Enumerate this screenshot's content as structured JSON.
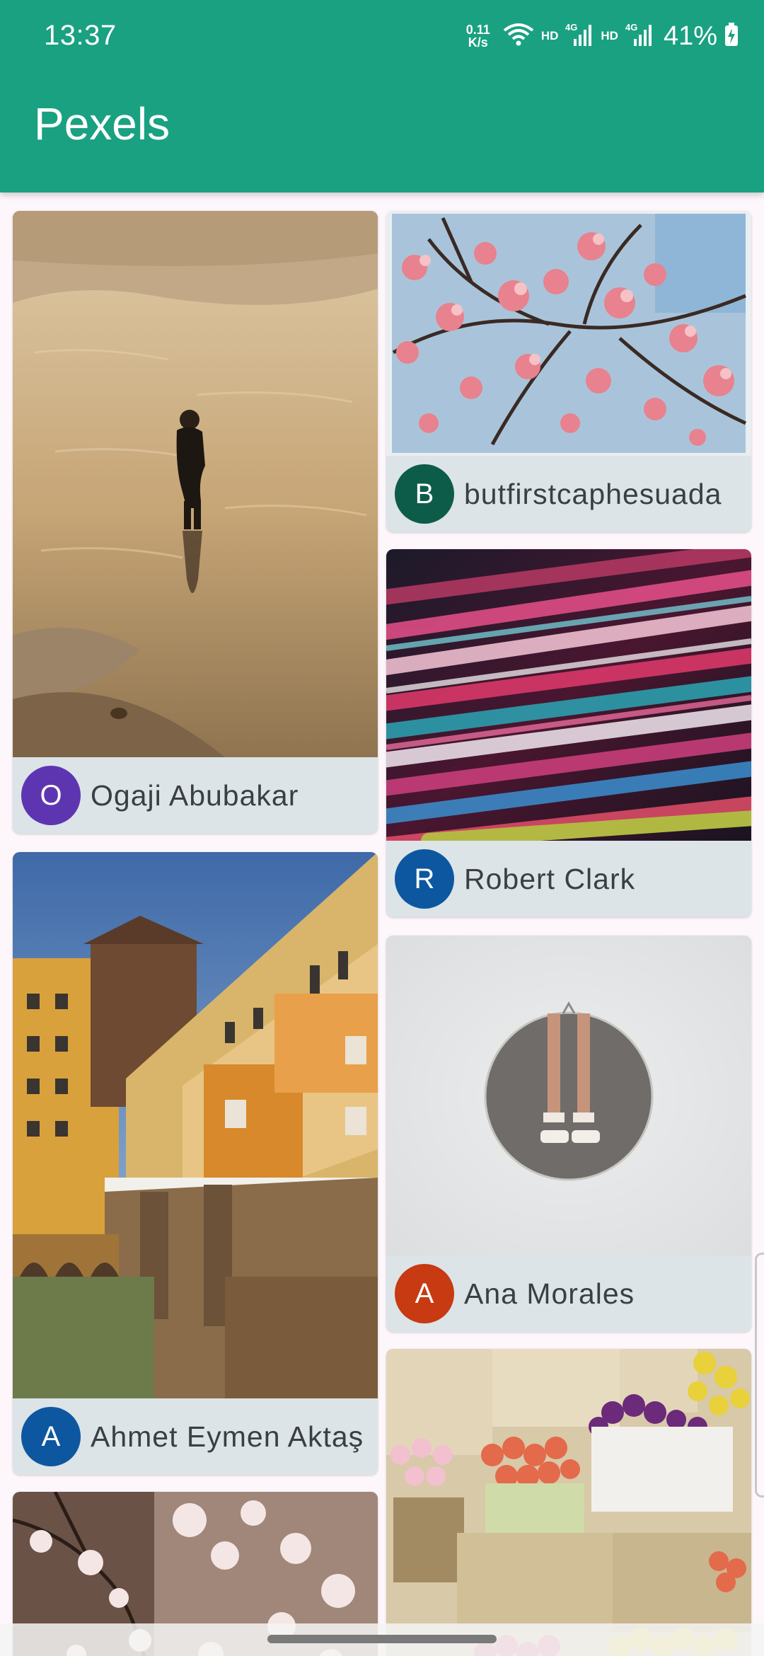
{
  "status_bar": {
    "time": "13:37",
    "net_speed_value": "0.11",
    "net_speed_unit": "K/s",
    "hd_label_1": "HD",
    "net_type_1": "4G",
    "hd_label_2": "HD",
    "net_type_2": "4G",
    "battery": "41%"
  },
  "toolbar": {
    "title": "Pexels"
  },
  "photos": [
    {
      "author": "Ogaji  Abubakar",
      "initial": "O",
      "avatar_color": "#5e35b1"
    },
    {
      "author": "butfirstcaphesuada",
      "initial": "B",
      "avatar_color": "#0d5c4a"
    },
    {
      "author": "Robert Clark",
      "initial": "R",
      "avatar_color": "#0d57a0"
    },
    {
      "author": "Ahmet Eymen Aktaş",
      "initial": "A",
      "avatar_color": "#0d57a0"
    },
    {
      "author": "Ana Morales",
      "initial": "A",
      "avatar_color": "#c73a12"
    }
  ],
  "colors": {
    "primary": "#1aa181",
    "card_footer": "#dce4e8",
    "background": "#fdf7fc"
  }
}
